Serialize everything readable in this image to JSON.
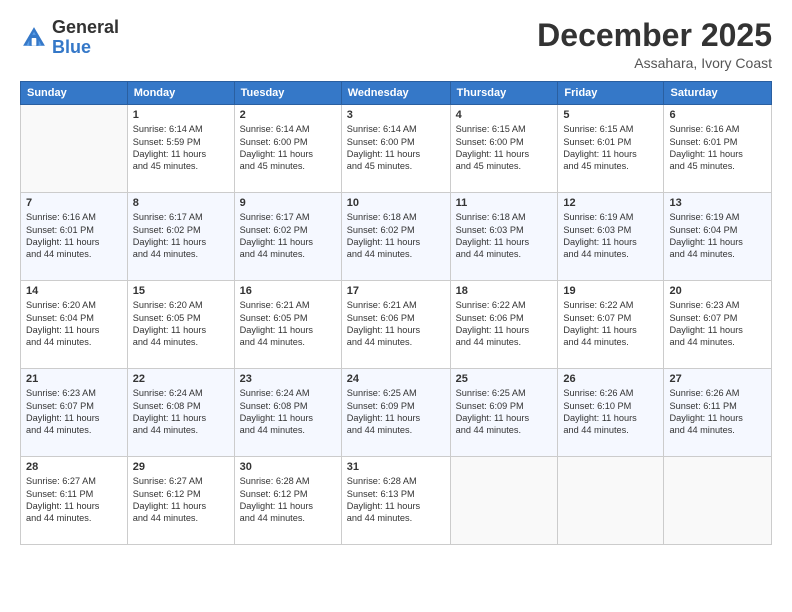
{
  "logo": {
    "general": "General",
    "blue": "Blue"
  },
  "header": {
    "month_year": "December 2025",
    "location": "Assahara, Ivory Coast"
  },
  "weekdays": [
    "Sunday",
    "Monday",
    "Tuesday",
    "Wednesday",
    "Thursday",
    "Friday",
    "Saturday"
  ],
  "weeks": [
    [
      {
        "day": "",
        "info": ""
      },
      {
        "day": "1",
        "info": "Sunrise: 6:14 AM\nSunset: 5:59 PM\nDaylight: 11 hours\nand 45 minutes."
      },
      {
        "day": "2",
        "info": "Sunrise: 6:14 AM\nSunset: 6:00 PM\nDaylight: 11 hours\nand 45 minutes."
      },
      {
        "day": "3",
        "info": "Sunrise: 6:14 AM\nSunset: 6:00 PM\nDaylight: 11 hours\nand 45 minutes."
      },
      {
        "day": "4",
        "info": "Sunrise: 6:15 AM\nSunset: 6:00 PM\nDaylight: 11 hours\nand 45 minutes."
      },
      {
        "day": "5",
        "info": "Sunrise: 6:15 AM\nSunset: 6:01 PM\nDaylight: 11 hours\nand 45 minutes."
      },
      {
        "day": "6",
        "info": "Sunrise: 6:16 AM\nSunset: 6:01 PM\nDaylight: 11 hours\nand 45 minutes."
      }
    ],
    [
      {
        "day": "7",
        "info": "Sunrise: 6:16 AM\nSunset: 6:01 PM\nDaylight: 11 hours\nand 44 minutes."
      },
      {
        "day": "8",
        "info": "Sunrise: 6:17 AM\nSunset: 6:02 PM\nDaylight: 11 hours\nand 44 minutes."
      },
      {
        "day": "9",
        "info": "Sunrise: 6:17 AM\nSunset: 6:02 PM\nDaylight: 11 hours\nand 44 minutes."
      },
      {
        "day": "10",
        "info": "Sunrise: 6:18 AM\nSunset: 6:02 PM\nDaylight: 11 hours\nand 44 minutes."
      },
      {
        "day": "11",
        "info": "Sunrise: 6:18 AM\nSunset: 6:03 PM\nDaylight: 11 hours\nand 44 minutes."
      },
      {
        "day": "12",
        "info": "Sunrise: 6:19 AM\nSunset: 6:03 PM\nDaylight: 11 hours\nand 44 minutes."
      },
      {
        "day": "13",
        "info": "Sunrise: 6:19 AM\nSunset: 6:04 PM\nDaylight: 11 hours\nand 44 minutes."
      }
    ],
    [
      {
        "day": "14",
        "info": "Sunrise: 6:20 AM\nSunset: 6:04 PM\nDaylight: 11 hours\nand 44 minutes."
      },
      {
        "day": "15",
        "info": "Sunrise: 6:20 AM\nSunset: 6:05 PM\nDaylight: 11 hours\nand 44 minutes."
      },
      {
        "day": "16",
        "info": "Sunrise: 6:21 AM\nSunset: 6:05 PM\nDaylight: 11 hours\nand 44 minutes."
      },
      {
        "day": "17",
        "info": "Sunrise: 6:21 AM\nSunset: 6:06 PM\nDaylight: 11 hours\nand 44 minutes."
      },
      {
        "day": "18",
        "info": "Sunrise: 6:22 AM\nSunset: 6:06 PM\nDaylight: 11 hours\nand 44 minutes."
      },
      {
        "day": "19",
        "info": "Sunrise: 6:22 AM\nSunset: 6:07 PM\nDaylight: 11 hours\nand 44 minutes."
      },
      {
        "day": "20",
        "info": "Sunrise: 6:23 AM\nSunset: 6:07 PM\nDaylight: 11 hours\nand 44 minutes."
      }
    ],
    [
      {
        "day": "21",
        "info": "Sunrise: 6:23 AM\nSunset: 6:07 PM\nDaylight: 11 hours\nand 44 minutes."
      },
      {
        "day": "22",
        "info": "Sunrise: 6:24 AM\nSunset: 6:08 PM\nDaylight: 11 hours\nand 44 minutes."
      },
      {
        "day": "23",
        "info": "Sunrise: 6:24 AM\nSunset: 6:08 PM\nDaylight: 11 hours\nand 44 minutes."
      },
      {
        "day": "24",
        "info": "Sunrise: 6:25 AM\nSunset: 6:09 PM\nDaylight: 11 hours\nand 44 minutes."
      },
      {
        "day": "25",
        "info": "Sunrise: 6:25 AM\nSunset: 6:09 PM\nDaylight: 11 hours\nand 44 minutes."
      },
      {
        "day": "26",
        "info": "Sunrise: 6:26 AM\nSunset: 6:10 PM\nDaylight: 11 hours\nand 44 minutes."
      },
      {
        "day": "27",
        "info": "Sunrise: 6:26 AM\nSunset: 6:11 PM\nDaylight: 11 hours\nand 44 minutes."
      }
    ],
    [
      {
        "day": "28",
        "info": "Sunrise: 6:27 AM\nSunset: 6:11 PM\nDaylight: 11 hours\nand 44 minutes."
      },
      {
        "day": "29",
        "info": "Sunrise: 6:27 AM\nSunset: 6:12 PM\nDaylight: 11 hours\nand 44 minutes."
      },
      {
        "day": "30",
        "info": "Sunrise: 6:28 AM\nSunset: 6:12 PM\nDaylight: 11 hours\nand 44 minutes."
      },
      {
        "day": "31",
        "info": "Sunrise: 6:28 AM\nSunset: 6:13 PM\nDaylight: 11 hours\nand 44 minutes."
      },
      {
        "day": "",
        "info": ""
      },
      {
        "day": "",
        "info": ""
      },
      {
        "day": "",
        "info": ""
      }
    ]
  ]
}
